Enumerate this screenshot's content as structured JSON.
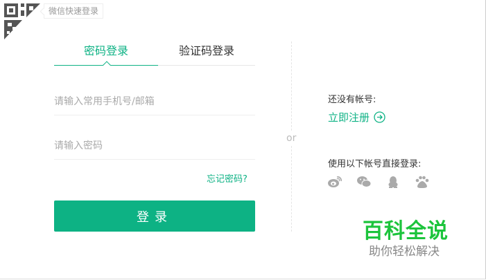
{
  "qr_tip": "微信快速登录",
  "tabs": [
    {
      "label": "密码登录",
      "active": true
    },
    {
      "label": "验证码登录",
      "active": false
    }
  ],
  "form": {
    "account_placeholder": "请输入常用手机号/邮箱",
    "password_placeholder": "请输入密码",
    "forgot_label": "忘记密码?",
    "login_label": "登录"
  },
  "divider_label": "or",
  "side": {
    "no_account": "还没有帐号:",
    "register_label": "立即注册",
    "third_party": "使用以下帐号直接登录:",
    "providers": [
      "weibo-icon",
      "wechat-icon",
      "qq-icon",
      "baidu-icon"
    ]
  },
  "watermark": {
    "title": "百科全说",
    "subtitle": "助你轻松解决"
  },
  "colors": {
    "accent": "#0db284",
    "watermark": "#1cc43c"
  }
}
